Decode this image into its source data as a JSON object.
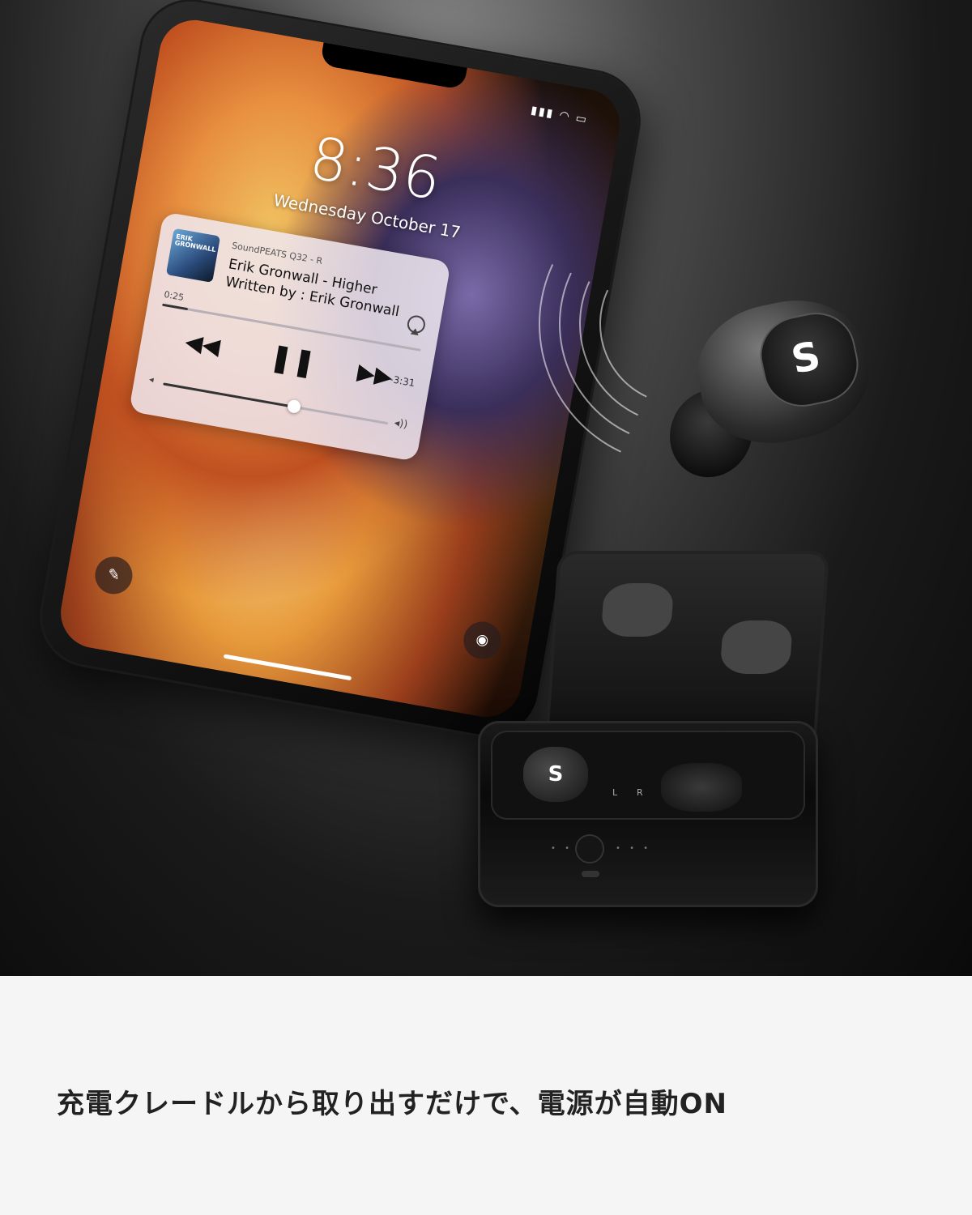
{
  "phone": {
    "time": "8:36",
    "date": "Wednesday October 17",
    "status_icons": "▮▮▮ ◠ ▭",
    "album_art_text": "ERIK GRONWALL",
    "music": {
      "app_name": "SoundPEATS Q32 - R",
      "title": "Erik Gronwall - Higher",
      "writer": "Written by : Erik Gronwall",
      "elapsed": "0:25",
      "remaining": "-3:31",
      "progress_fraction": 0.1,
      "volume_fraction": 0.58
    },
    "icons": {
      "rewind": "◀◀",
      "pause": "❚❚",
      "forward": "▶▶",
      "vol_low": "◂",
      "vol_high": "◂))",
      "flashlight": "✎",
      "camera": "◉"
    }
  },
  "earbud": {
    "logo": "S"
  },
  "case": {
    "left_label": "L",
    "right_label": "R",
    "bud_logo": "S",
    "led_dots": "• • •"
  },
  "caption": "充電クレードルから取り出すだけで、電源が自動ON"
}
